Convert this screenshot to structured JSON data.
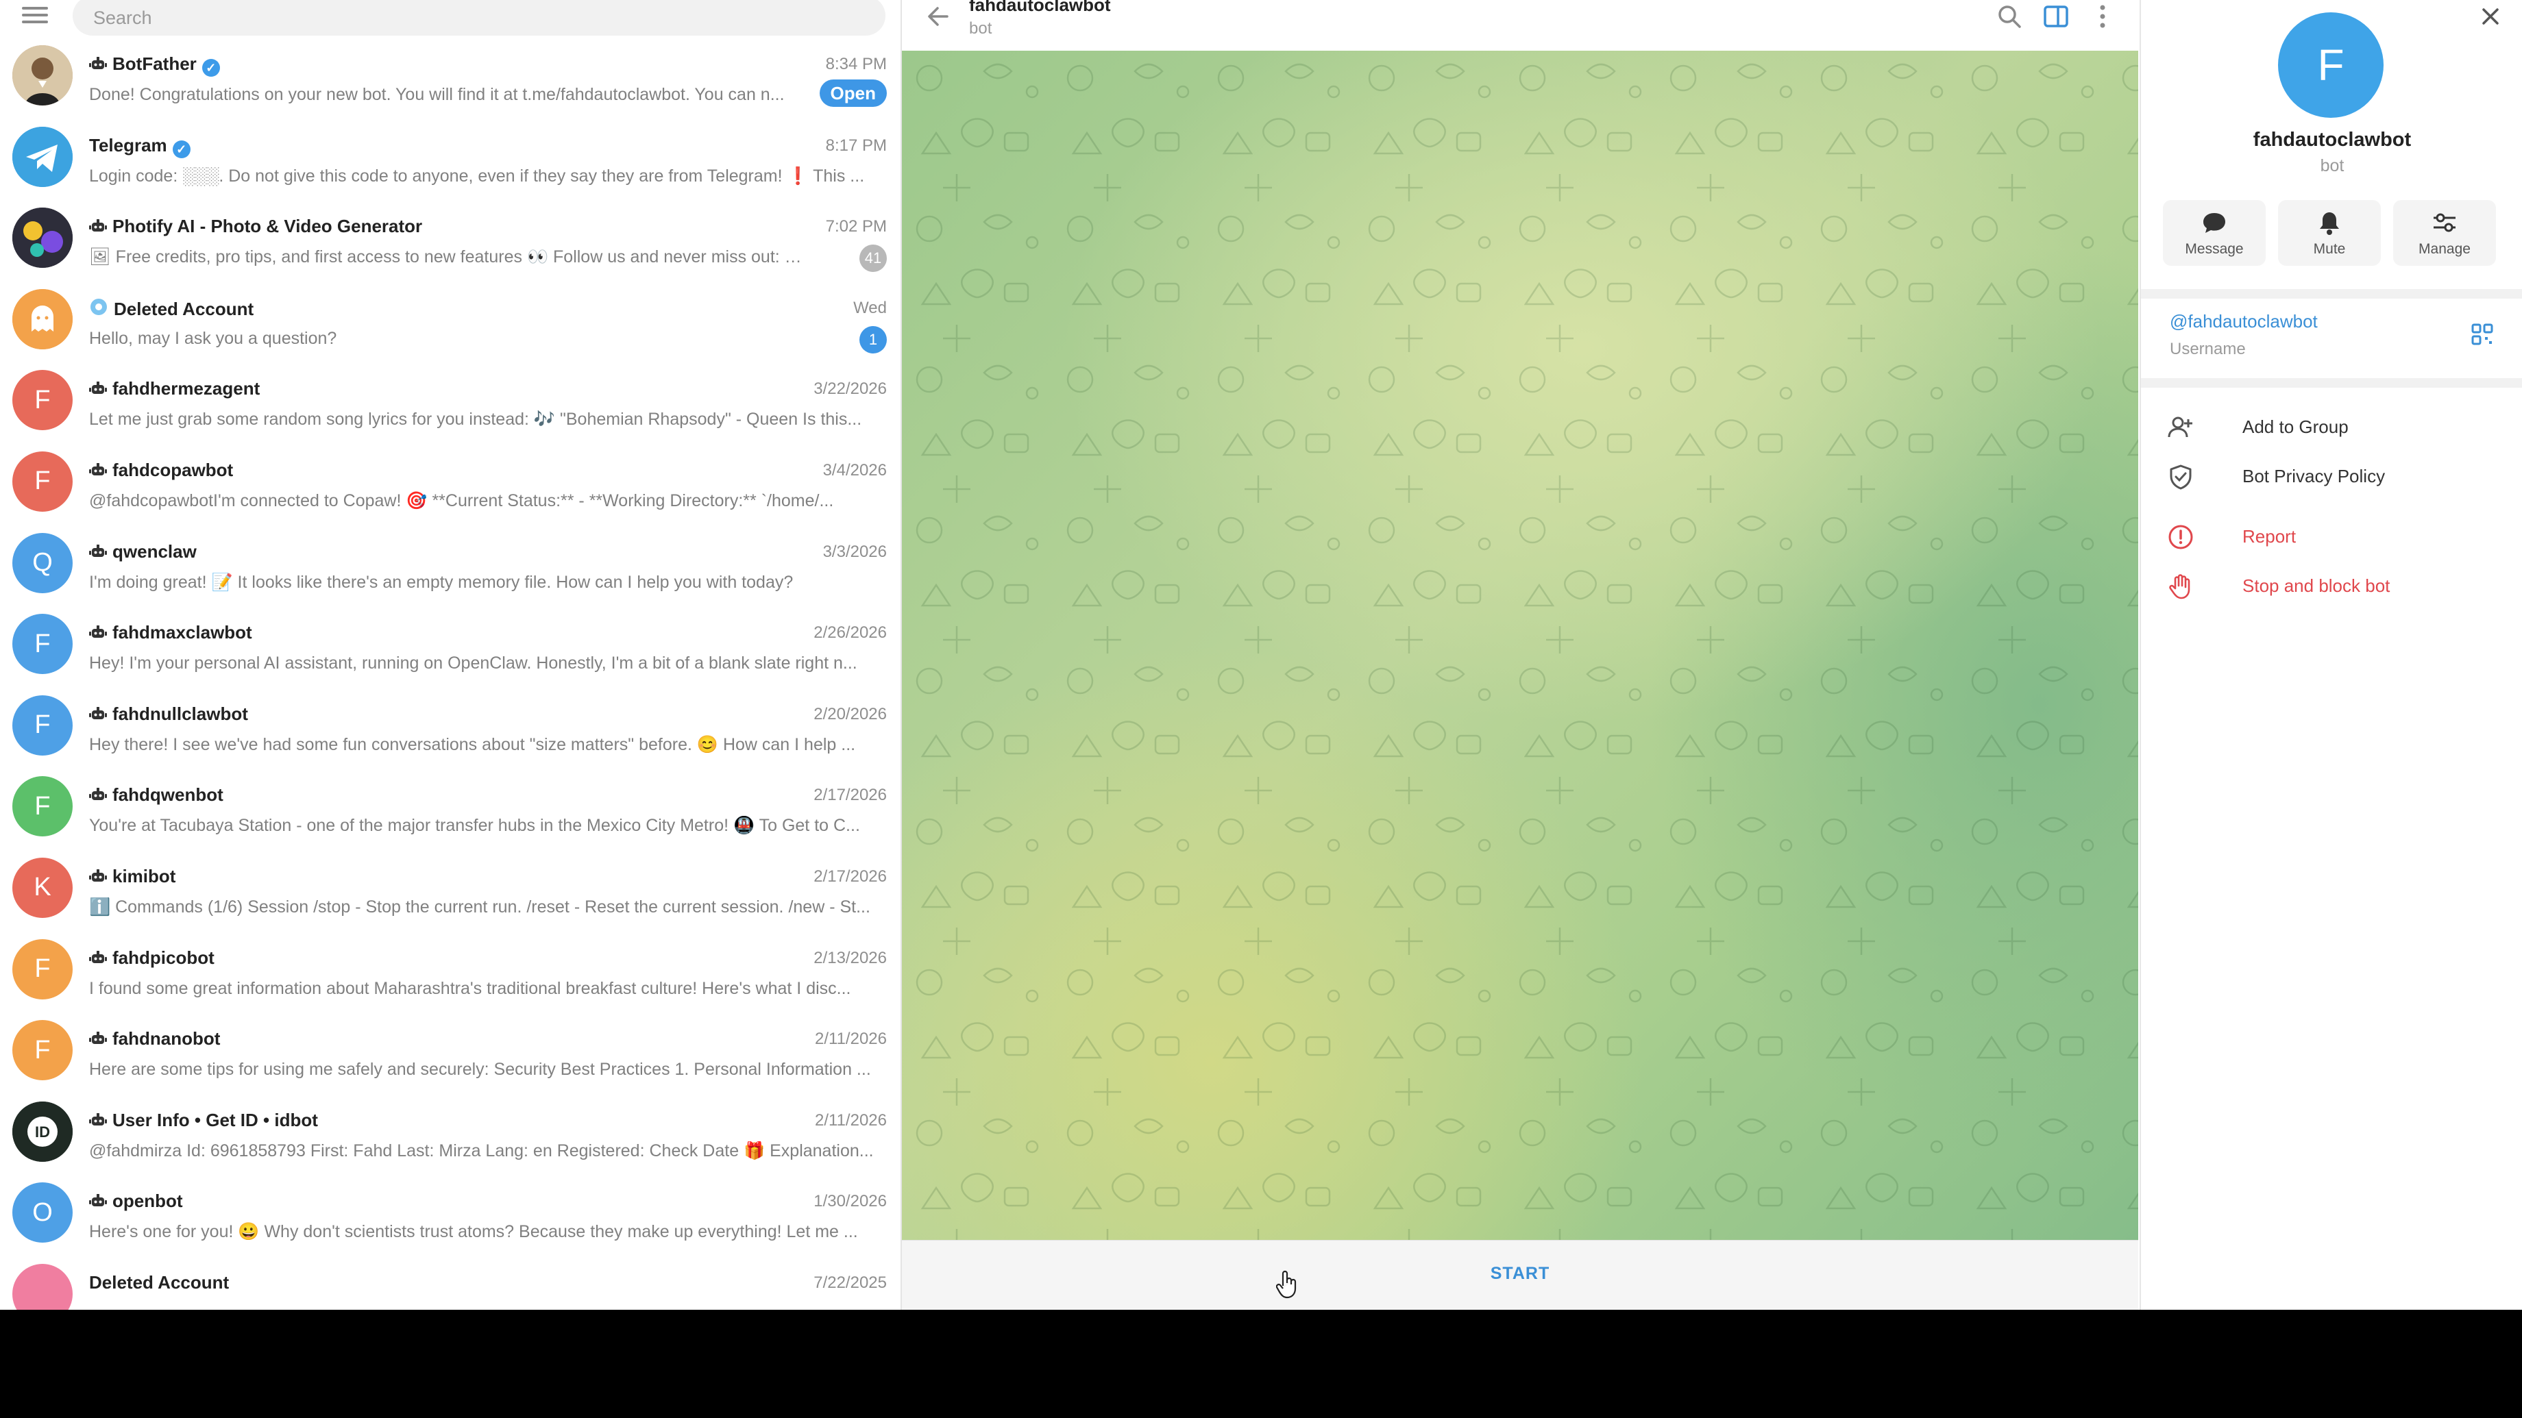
{
  "sidebar": {
    "search_placeholder": "Search",
    "chats": [
      {
        "title": "BotFather",
        "verified": true,
        "bot": true,
        "time": "8:34 PM",
        "preview": "Done! Congratulations on your new bot. You will find it at t.me/fahdautoclawbot. You can n...",
        "action": "Open",
        "avatar_color": "#c89a6a",
        "avatar_letter": "",
        "avatar_icon": "botfather-avatar-icon"
      },
      {
        "title": "Telegram",
        "verified": true,
        "bot": false,
        "time": "8:17 PM",
        "preview": "Login code: ░░░. Do not give this code to anyone, even if they say they are from Telegram! ❗ This ...",
        "avatar_color": "#3ca3e0",
        "avatar_letter": "",
        "avatar_icon": "telegram-avatar-icon"
      },
      {
        "title": "Photify AI - Photo & Video Generator",
        "verified": false,
        "bot": true,
        "time": "7:02 PM",
        "preview": "🖼 Free credits, pro tips, and first access to new features 👀  Follow us and never miss out: 💙 ...",
        "badge": "41",
        "badge_color": "gray",
        "avatar_color": "#2d2d3a",
        "avatar_letter": "",
        "avatar_icon": "photify-avatar-icon"
      },
      {
        "title": "Deleted Account",
        "verified": false,
        "bot": false,
        "time": "Wed",
        "preview": "Hello, may I ask you a question?",
        "badge": "1",
        "badge_color": "blue",
        "avatar_color": "#f3a24a",
        "avatar_letter": "",
        "avatar_icon": "ghost-avatar-icon",
        "title_icon": "deleted-flower-icon"
      },
      {
        "title": "fahdhermezagent",
        "verified": false,
        "bot": true,
        "time": "3/22/2026",
        "preview": "Let me just grab some random song lyrics for you instead: 🎶 \"Bohemian Rhapsody\" - Queen  Is this...",
        "avatar_color": "#e76a5a",
        "avatar_letter": "F"
      },
      {
        "title": "fahdcopawbot",
        "verified": false,
        "bot": true,
        "time": "3/4/2026",
        "preview": "@fahdcopawbotI'm connected to Copaw! 🎯  **Current Status:** - **Working Directory:**  `/home/...",
        "avatar_color": "#e76a5a",
        "avatar_letter": "F"
      },
      {
        "title": "qwenclaw",
        "verified": false,
        "bot": true,
        "time": "3/3/2026",
        "preview": "I'm doing great! 📝  It looks like there's an empty memory file. How can I help you with today?",
        "avatar_color": "#4ea0e6",
        "avatar_letter": "Q"
      },
      {
        "title": "fahdmaxclawbot",
        "verified": false,
        "bot": true,
        "time": "2/26/2026",
        "preview": "Hey! I'm your personal AI assistant, running on OpenClaw.  Honestly, I'm a bit of a blank slate right n...",
        "avatar_color": "#4ea0e6",
        "avatar_letter": "F"
      },
      {
        "title": "fahdnullclawbot",
        "verified": false,
        "bot": true,
        "time": "2/20/2026",
        "preview": "Hey there! I see we've had some fun conversations about \"size matters\" before. 😊  How can I help ...",
        "avatar_color": "#4ea0e6",
        "avatar_letter": "F"
      },
      {
        "title": "fahdqwenbot",
        "verified": false,
        "bot": true,
        "time": "2/17/2026",
        "preview": "You're at Tacubaya Station - one of the major transfer hubs in the Mexico City Metro! 🚇  To Get to C...",
        "avatar_color": "#5cc06a",
        "avatar_letter": "F"
      },
      {
        "title": "kimibot",
        "verified": false,
        "bot": true,
        "time": "2/17/2026",
        "preview": "ℹ️ Commands (1/6)  Session /stop - Stop the current run. /reset - Reset the current session. /new - St...",
        "avatar_color": "#e76a5a",
        "avatar_letter": "K"
      },
      {
        "title": "fahdpicobot",
        "verified": false,
        "bot": true,
        "time": "2/13/2026",
        "preview": "I found some great information about Maharashtra's traditional breakfast culture! Here's what I disc...",
        "avatar_color": "#f3a24a",
        "avatar_letter": "F"
      },
      {
        "title": "fahdnanobot",
        "verified": false,
        "bot": true,
        "time": "2/11/2026",
        "preview": "Here are some tips for using me safely and securely:  Security Best Practices  1. Personal Information ...",
        "avatar_color": "#f3a24a",
        "avatar_letter": "F"
      },
      {
        "title": "User Info • Get ID • idbot",
        "verified": false,
        "bot": true,
        "time": "2/11/2026",
        "preview": "@fahdmirza Id: 6961858793 First: Fahd Last: Mirza Lang: en Registered: Check Date 🎁 Explanation...",
        "avatar_color": "#1f2a24",
        "avatar_letter": "",
        "avatar_icon": "idbot-avatar-icon"
      },
      {
        "title": "openbot",
        "verified": false,
        "bot": true,
        "time": "1/30/2026",
        "preview": "Here's one for you! 😀  Why don't scientists trust atoms? Because they make up everything!  Let me ...",
        "avatar_color": "#4ea0e6",
        "avatar_letter": "O"
      },
      {
        "title": "Deleted Account",
        "verified": false,
        "bot": false,
        "time": "7/22/2025",
        "preview": "",
        "avatar_color": "#f07ea0",
        "avatar_letter": ""
      }
    ]
  },
  "chat": {
    "title": "fahdautoclawbot",
    "subtitle": "bot",
    "start_label": "START"
  },
  "profile": {
    "avatar_letter": "F",
    "name": "fahdautoclawbot",
    "subtitle": "bot",
    "actions": [
      {
        "label": "Message",
        "icon": "chat-bubble-icon"
      },
      {
        "label": "Mute",
        "icon": "bell-icon"
      },
      {
        "label": "Manage",
        "icon": "sliders-icon"
      }
    ],
    "username": "@fahdautoclawbot",
    "username_label": "Username",
    "menu": [
      {
        "label": "Add to Group",
        "icon": "add-user-icon",
        "color": "#333333"
      },
      {
        "label": "Bot Privacy Policy",
        "icon": "shield-icon",
        "color": "#333333"
      },
      {
        "label": "Report",
        "icon": "report-icon",
        "color": "#e0474c"
      },
      {
        "label": "Stop and block bot",
        "icon": "hand-stop-icon",
        "color": "#e0474c"
      }
    ]
  },
  "colors": {
    "accent": "#3a8fd6",
    "danger": "#e0474c",
    "badge_gray": "#b8b8b8"
  }
}
